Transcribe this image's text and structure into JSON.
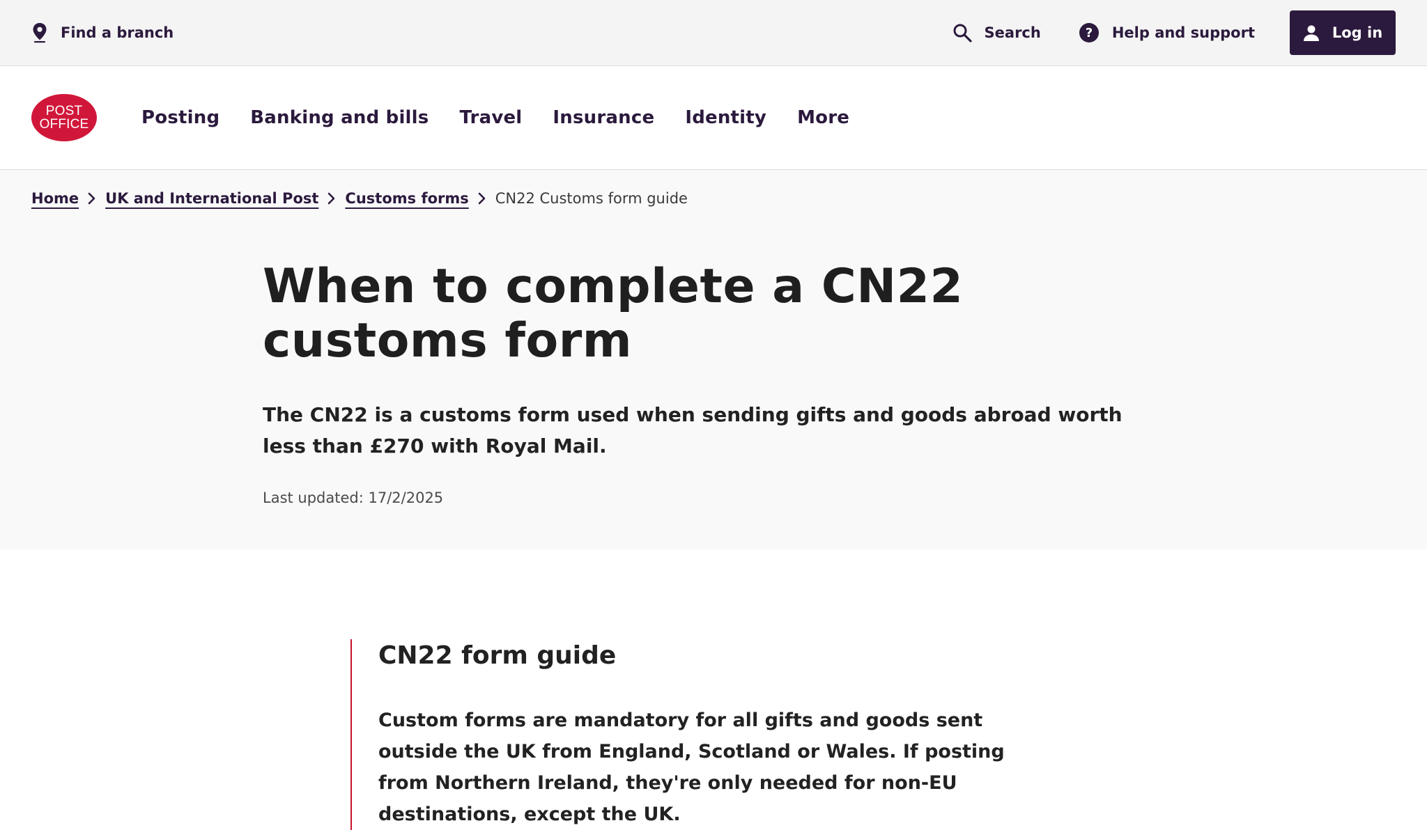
{
  "utility": {
    "find_branch": "Find a branch",
    "search": "Search",
    "help": "Help and support",
    "login": "Log in"
  },
  "logo": {
    "line1": "POST",
    "line2": "OFFICE",
    "color": "#d0173a"
  },
  "nav": {
    "items": [
      {
        "label": "Posting"
      },
      {
        "label": "Banking and bills"
      },
      {
        "label": "Travel"
      },
      {
        "label": "Insurance"
      },
      {
        "label": "Identity"
      },
      {
        "label": "More"
      }
    ]
  },
  "breadcrumb": {
    "home": "Home",
    "uk_post": "UK and International Post",
    "customs": "Customs forms",
    "current": "CN22 Customs form guide"
  },
  "hero": {
    "title": "When to complete a CN22 customs form",
    "intro": "The CN22 is a customs form used when sending gifts and goods abroad worth less than £270 with Royal Mail.",
    "last_updated": "Last updated: 17/2/2025"
  },
  "guide": {
    "heading": "CN22 form guide",
    "text": "Custom forms are mandatory for all gifts and goods sent outside the UK from England, Scotland or Wales. If posting from Northern Ireland, they're only needed for non-EU destinations, except the UK."
  },
  "colors": {
    "brand_purple": "#2b1a3d",
    "brand_red": "#c8102e"
  },
  "icons": [
    "location-pin-icon",
    "search-icon",
    "help-icon",
    "user-icon",
    "chevron-right-icon"
  ]
}
